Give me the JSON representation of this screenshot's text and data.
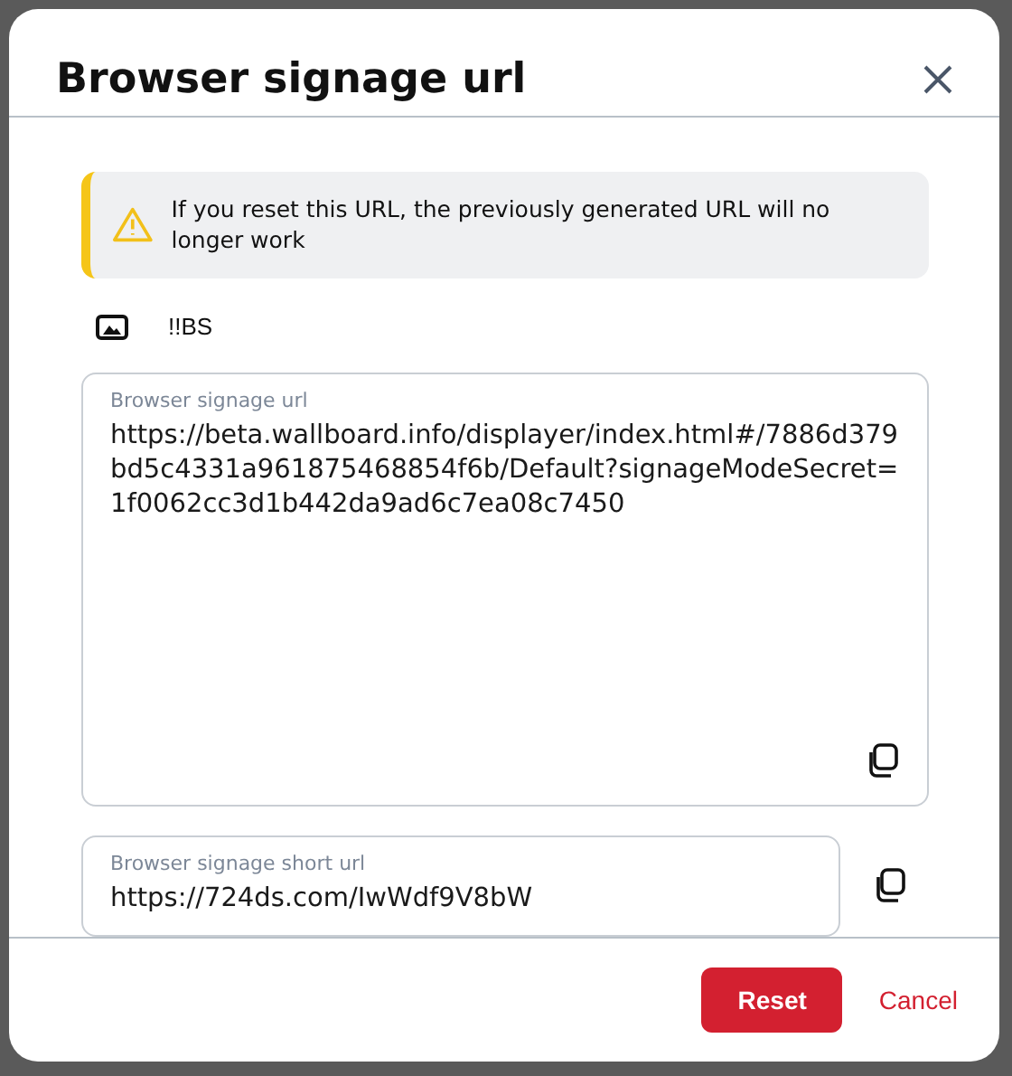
{
  "dialog": {
    "title": "Browser signage url"
  },
  "alert": {
    "message": "If you reset this URL, the previously generated URL will no longer work"
  },
  "display": {
    "name": "!!BS"
  },
  "fields": [
    {
      "kind": "textarea",
      "label": "Browser signage url",
      "value": "https://beta.wallboard.info/displayer/index.html#/7886d379bd5c4331a961875468854f6b/Default?signageModeSecret=1f0062cc3d1b442da9ad6c7ea08c7450"
    },
    {
      "kind": "input",
      "label": "Browser signage short url",
      "value": "https://724ds.com/IwWdf9V8bW"
    }
  ],
  "buttons": [
    {
      "label": "Reset",
      "kind": "primary"
    },
    {
      "label": "Cancel",
      "kind": "link"
    }
  ]
}
